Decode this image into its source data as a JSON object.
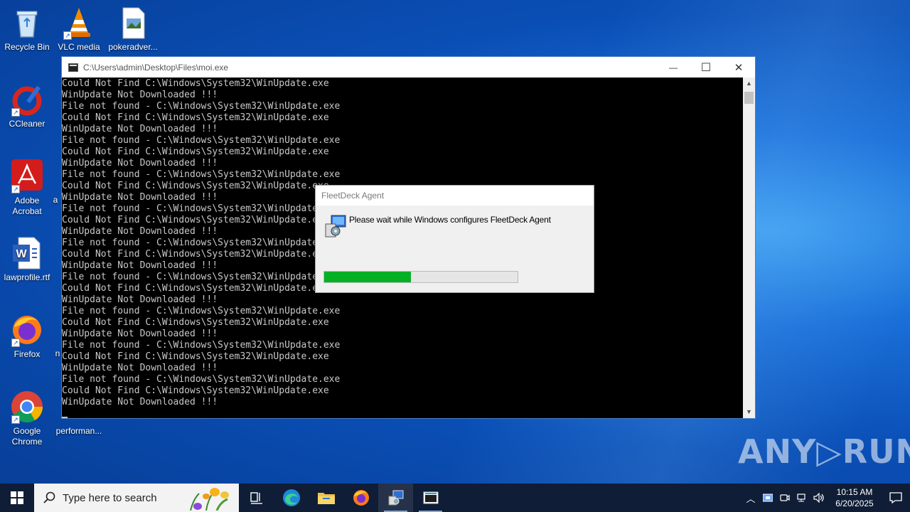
{
  "desktop": {
    "icons": [
      {
        "label": "Recycle Bin",
        "icon": "recycle-bin-icon"
      },
      {
        "label": "VLC media",
        "icon": "vlc-icon"
      },
      {
        "label": "pokeradver...",
        "icon": "document-icon"
      },
      {
        "label": "CCleaner",
        "icon": "ccleaner-icon"
      },
      {
        "label": "Adobe Acrobat",
        "icon": "adobe-acrobat-icon"
      },
      {
        "label": "lawprofile.rtf",
        "icon": "word-document-icon"
      },
      {
        "label": "Firefox",
        "icon": "firefox-icon"
      },
      {
        "label": "Google Chrome",
        "icon": "chrome-icon"
      },
      {
        "label": "performan...",
        "icon": "file-icon"
      }
    ],
    "hidden_partial_labels": [
      "a",
      "n"
    ]
  },
  "console": {
    "title": "C:\\Users\\admin\\Desktop\\Files\\moi.exe",
    "minimize": "—",
    "maximize": "☐",
    "close": "✕",
    "lines": [
      "Could Not Find C:\\Windows\\System32\\WinUpdate.exe",
      "WinUpdate Not Downloaded !!!",
      "File not found - C:\\Windows\\System32\\WinUpdate.exe",
      "Could Not Find C:\\Windows\\System32\\WinUpdate.exe",
      "WinUpdate Not Downloaded !!!",
      "File not found - C:\\Windows\\System32\\WinUpdate.exe",
      "Could Not Find C:\\Windows\\System32\\WinUpdate.exe",
      "WinUpdate Not Downloaded !!!",
      "File not found - C:\\Windows\\System32\\WinUpdate.exe",
      "Could Not Find C:\\Windows\\System32\\WinUpdate.exe",
      "WinUpdate Not Downloaded !!!",
      "File not found - C:\\Windows\\System32\\WinUpdate.exe",
      "Could Not Find C:\\Windows\\System32\\WinUpdate.exe",
      "WinUpdate Not Downloaded !!!",
      "File not found - C:\\Windows\\System32\\WinUpdate.exe",
      "Could Not Find C:\\Windows\\System32\\WinUpdate.exe",
      "WinUpdate Not Downloaded !!!",
      "File not found - C:\\Windows\\System32\\WinUpdate.exe",
      "Could Not Find C:\\Windows\\System32\\WinUpdate.exe",
      "WinUpdate Not Downloaded !!!",
      "File not found - C:\\Windows\\System32\\WinUpdate.exe",
      "Could Not Find C:\\Windows\\System32\\WinUpdate.exe",
      "WinUpdate Not Downloaded !!!",
      "File not found - C:\\Windows\\System32\\WinUpdate.exe",
      "Could Not Find C:\\Windows\\System32\\WinUpdate.exe",
      "WinUpdate Not Downloaded !!!",
      "File not found - C:\\Windows\\System32\\WinUpdate.exe",
      "Could Not Find C:\\Windows\\System32\\WinUpdate.exe",
      "WinUpdate Not Downloaded !!!"
    ]
  },
  "installer": {
    "title": "FleetDeck Agent",
    "message": "Please wait while Windows configures FleetDeck Agent",
    "progress_percent": 45,
    "progress_color": "#06b025"
  },
  "watermark": "ANY▷RUN",
  "taskbar": {
    "search_placeholder": "Type here to search",
    "time": "10:15 AM",
    "date": "6/20/2025",
    "apps": [
      "task-view-icon",
      "edge-icon",
      "file-explorer-icon",
      "firefox-icon",
      "installer-icon",
      "console-icon"
    ]
  }
}
